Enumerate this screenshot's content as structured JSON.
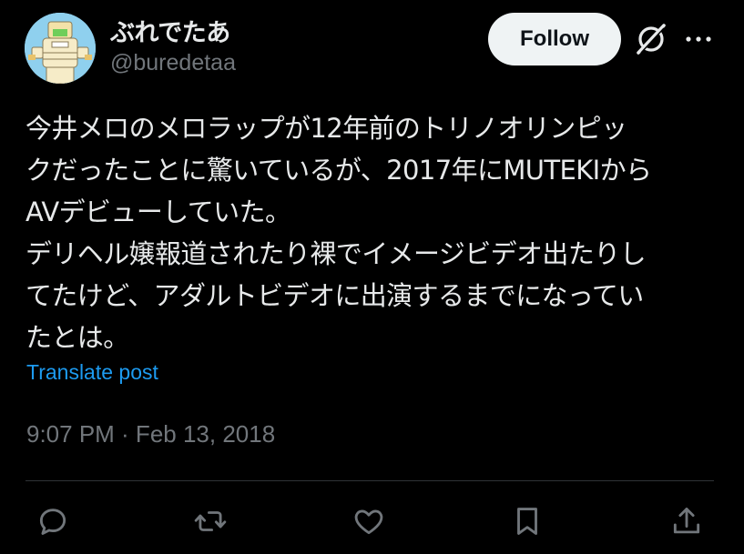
{
  "author": {
    "display_name": "ぶれでたあ",
    "handle": "@buredetaa",
    "avatar_icon": "avatar-character-icon"
  },
  "header": {
    "follow_label": "Follow",
    "grok_icon": "grok-icon",
    "more_icon": "more-icon"
  },
  "tweet": {
    "lines": [
      "今井メロのメロラップが12年前のトリノオリンピッ",
      "クだったことに驚いているが、2017年にMUTEKIから",
      "AVデビューしていた。",
      "デリヘル嬢報道されたり裸でイメージビデオ出たりし",
      "てたけど、アダルトビデオに出演するまでになってい",
      "たとは。"
    ],
    "translate_label": "Translate post",
    "timestamp": "9:07 PM · Feb 13, 2018"
  },
  "actions": {
    "reply_icon": "reply-icon",
    "repost_icon": "repost-icon",
    "like_icon": "like-icon",
    "bookmark_icon": "bookmark-icon",
    "share_icon": "share-icon"
  },
  "colors": {
    "background": "#000000",
    "text": "#e7e9ea",
    "muted": "#71767b",
    "link": "#1d9bf0",
    "follow_bg": "#eff3f4"
  }
}
